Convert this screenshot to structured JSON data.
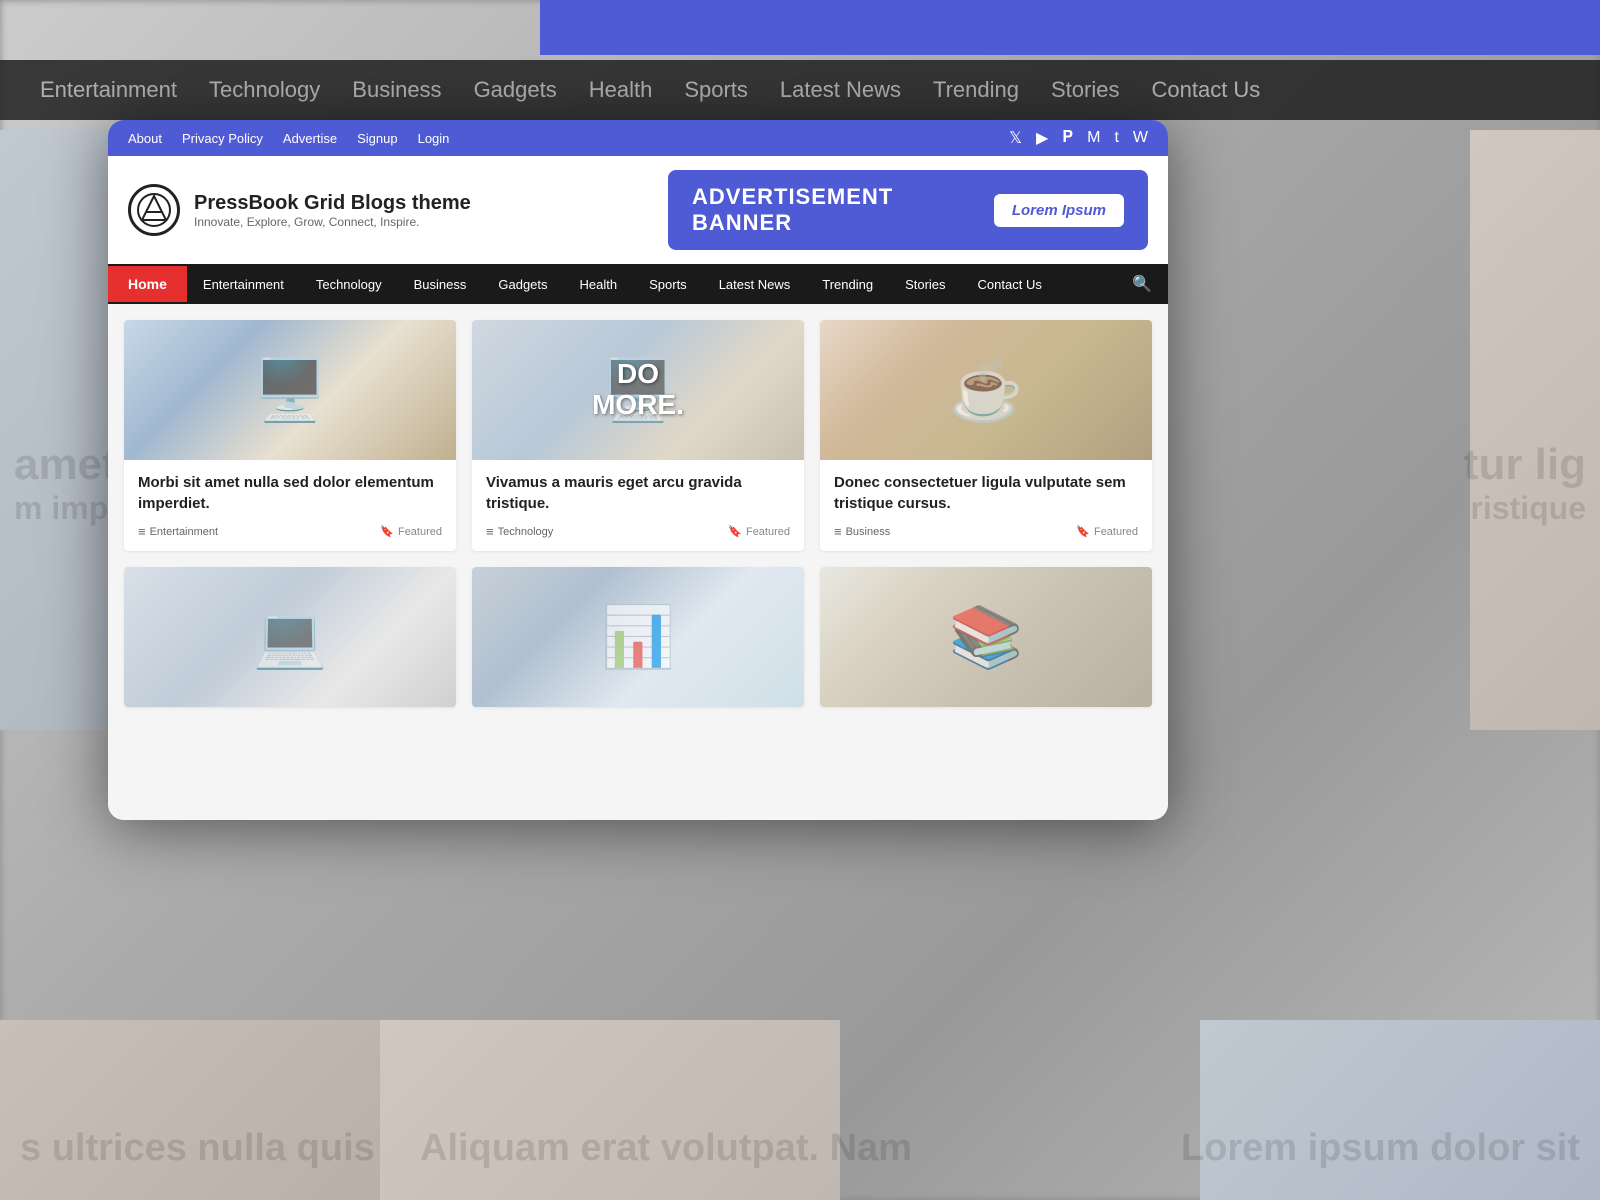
{
  "background": {
    "top_nav_items": [
      "Entertainment",
      "Technology",
      "Business",
      "Gadgets",
      "Health",
      "Sports",
      "Latest News",
      "Trending",
      "Stories",
      "Contact Us"
    ]
  },
  "modal": {
    "topbar": {
      "links": [
        "About",
        "Privacy Policy",
        "Advertise",
        "Signup",
        "Login"
      ],
      "social_icons": [
        "twitter",
        "youtube",
        "pinterest",
        "medium",
        "tumblr",
        "wordpress"
      ]
    },
    "header": {
      "logo_letter": "⟁",
      "site_name": "PressBook Grid Blogs theme",
      "tagline": "Innovate, Explore, Grow, Connect, Inspire.",
      "ad_banner_text": "ADVERTISEMENT BANNER",
      "ad_banner_btn": "Lorem Ipsum"
    },
    "nav": {
      "home": "Home",
      "items": [
        "Entertainment",
        "Technology",
        "Business",
        "Gadgets",
        "Health",
        "Sports",
        "Latest News",
        "Trending",
        "Stories",
        "Contact Us"
      ]
    },
    "cards": [
      {
        "title": "Morbi sit amet nulla sed dolor elementum imperdiet.",
        "category": "Entertainment",
        "badge": "Featured",
        "image_type": "desk1"
      },
      {
        "title": "Vivamus a mauris eget arcu gravida tristique.",
        "category": "Technology",
        "badge": "Featured",
        "image_type": "desk2"
      },
      {
        "title": "Donec consectetuer ligula vulputate sem tristique cursus.",
        "category": "Business",
        "badge": "Featured",
        "image_type": "coffee"
      },
      {
        "title": "",
        "category": "",
        "badge": "",
        "image_type": "office1"
      },
      {
        "title": "",
        "category": "",
        "badge": "",
        "image_type": "monitor"
      },
      {
        "title": "",
        "category": "",
        "badge": "",
        "image_type": "books"
      }
    ]
  },
  "bg_bottom": {
    "text1": "s ultrices nulla quis",
    "text2": "Aliquam erat volutpat. Nam",
    "text3": "Lorem ipsum dolor sit"
  }
}
